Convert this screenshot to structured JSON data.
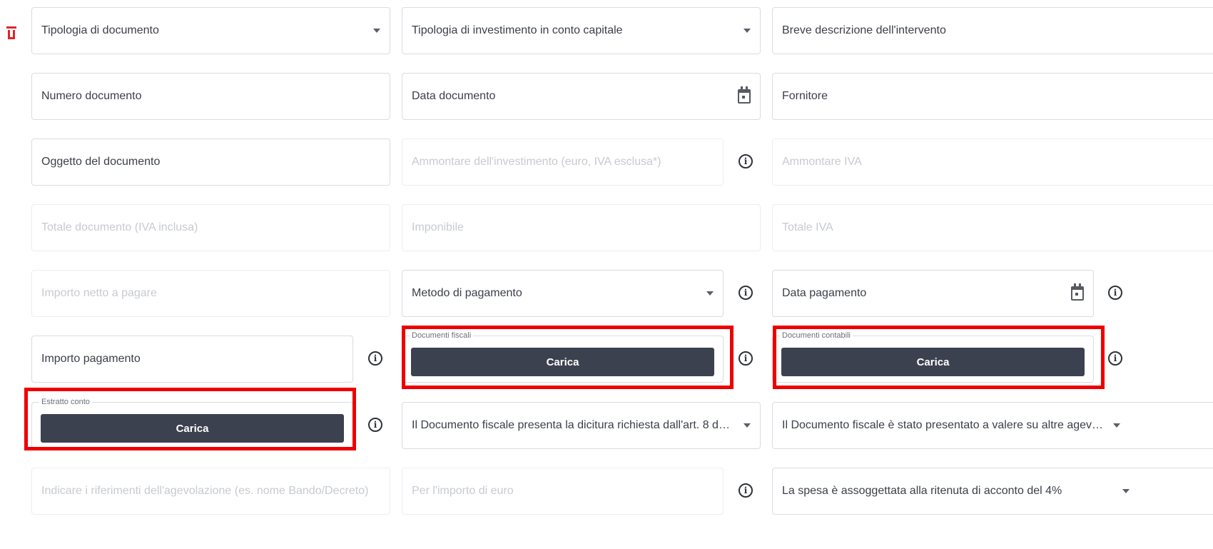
{
  "delete_icon": "trash-icon",
  "accent_color": "#ee0000",
  "button_color": "#3c414f",
  "fields": {
    "tipologia_documento": "Tipologia di documento",
    "tipologia_investimento": "Tipologia di investimento in conto capitale",
    "breve_descrizione": "Breve descrizione dell'intervento",
    "numero_documento": "Numero documento",
    "data_documento": "Data documento",
    "fornitore": "Fornitore",
    "oggetto_documento": "Oggetto del documento",
    "ammontare_investimento": "Ammontare dell'investimento (euro, IVA esclusa*)",
    "ammontare_iva": "Ammontare IVA",
    "totale_documento": "Totale documento (IVA inclusa)",
    "imponibile": "Imponibile",
    "totale_iva": "Totale IVA",
    "importo_netto": "Importo netto a pagare",
    "metodo_pagamento": "Metodo di pagamento",
    "data_pagamento": "Data pagamento",
    "importo_pagamento": "Importo pagamento",
    "dicitura_art8": "Il Documento fiscale presenta la dicitura richiesta dall'art. 8 del ...",
    "altre_agevolazioni": "Il Documento fiscale è stato presentato a valere su altre agevola...",
    "riferimenti_agevolazione": "Indicare i riferimenti dell'agevolazione (es. nome Bando/Decreto)",
    "per_importo": "Per l'importo di euro",
    "ritenuta_acconto": "La spesa è assoggettata alla ritenuta di acconto del 4%"
  },
  "uploads": {
    "documenti_fiscali": {
      "legend": "Documenti fiscali",
      "button": "Carica"
    },
    "documenti_contabili": {
      "legend": "Documenti contabili",
      "button": "Carica"
    },
    "estratto_conto": {
      "legend": "Estratto conto",
      "button": "Carica"
    }
  },
  "icons": {
    "info": "info-icon",
    "info_glyph": "i",
    "calendar": "calendar-icon",
    "dropdown": "chevron-down-icon"
  }
}
